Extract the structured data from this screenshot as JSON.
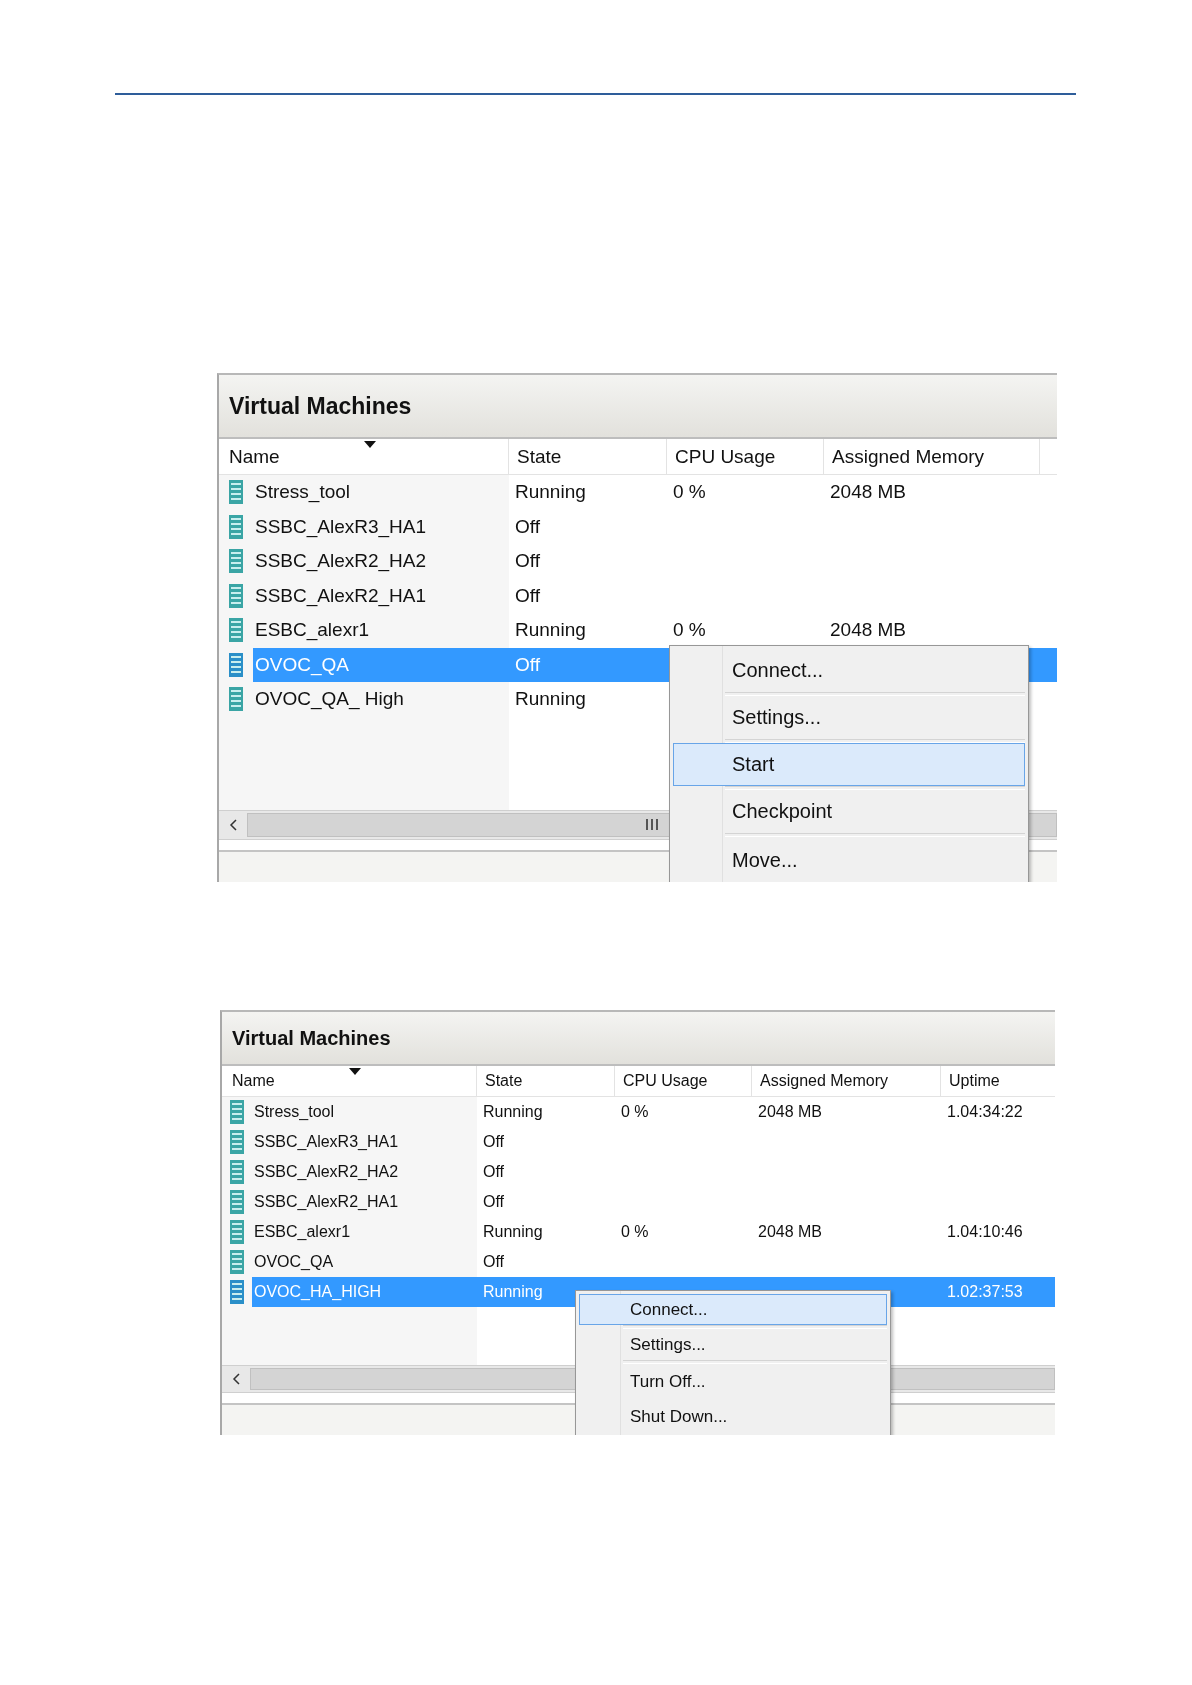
{
  "figures": [
    {
      "title": "Virtual Machines",
      "columns": [
        "Name",
        "State",
        "CPU Usage",
        "Assigned Memory"
      ],
      "rows": [
        {
          "name": "Stress_tool",
          "state": "Running",
          "cpu": "0 %",
          "memory": "2048 MB",
          "selected": false
        },
        {
          "name": "SSBC_AlexR3_HA1",
          "state": "Off",
          "selected": false
        },
        {
          "name": "SSBC_AlexR2_HA2",
          "state": "Off",
          "selected": false
        },
        {
          "name": "SSBC_AlexR2_HA1",
          "state": "Off",
          "selected": false
        },
        {
          "name": "ESBC_alexr1",
          "state": "Running",
          "cpu": "0 %",
          "memory": "2048 MB",
          "selected": false
        },
        {
          "name": "OVOC_QA",
          "state": "Off",
          "selected": true
        },
        {
          "name": "OVOC_QA_ High",
          "state": "Running",
          "selected": false
        }
      ],
      "context_menu": {
        "items": [
          {
            "label": "Connect...",
            "selected": false,
            "separator_after": true
          },
          {
            "label": "Settings...",
            "selected": false,
            "separator_after": true
          },
          {
            "label": "Start",
            "selected": true,
            "separator_after": true
          },
          {
            "label": "Checkpoint",
            "selected": false,
            "separator_after": true
          },
          {
            "label": "Move...",
            "selected": false,
            "separator_after": false
          }
        ]
      }
    },
    {
      "title": "Virtual Machines",
      "columns": [
        "Name",
        "State",
        "CPU Usage",
        "Assigned Memory",
        "Uptime"
      ],
      "rows": [
        {
          "name": "Stress_tool",
          "state": "Running",
          "cpu": "0 %",
          "memory": "2048 MB",
          "uptime": "1.04:34:22",
          "selected": false
        },
        {
          "name": "SSBC_AlexR3_HA1",
          "state": "Off",
          "selected": false
        },
        {
          "name": "SSBC_AlexR2_HA2",
          "state": "Off",
          "selected": false
        },
        {
          "name": "SSBC_AlexR2_HA1",
          "state": "Off",
          "selected": false
        },
        {
          "name": "ESBC_alexr1",
          "state": "Running",
          "cpu": "0 %",
          "memory": "2048 MB",
          "uptime": "1.04:10:46",
          "selected": false
        },
        {
          "name": "OVOC_QA",
          "state": "Off",
          "selected": false
        },
        {
          "name": "OVOC_HA_HIGH",
          "state": "Running",
          "uptime": "1.02:37:53",
          "selected": true
        }
      ],
      "context_menu": {
        "items": [
          {
            "label": "Connect...",
            "selected": true,
            "separator_after": true
          },
          {
            "label": "Settings...",
            "selected": false,
            "separator_after": true
          },
          {
            "label": "Turn Off...",
            "selected": false,
            "separator_after": false
          },
          {
            "label": "Shut Down...",
            "selected": false,
            "separator_after": false
          }
        ]
      }
    }
  ]
}
